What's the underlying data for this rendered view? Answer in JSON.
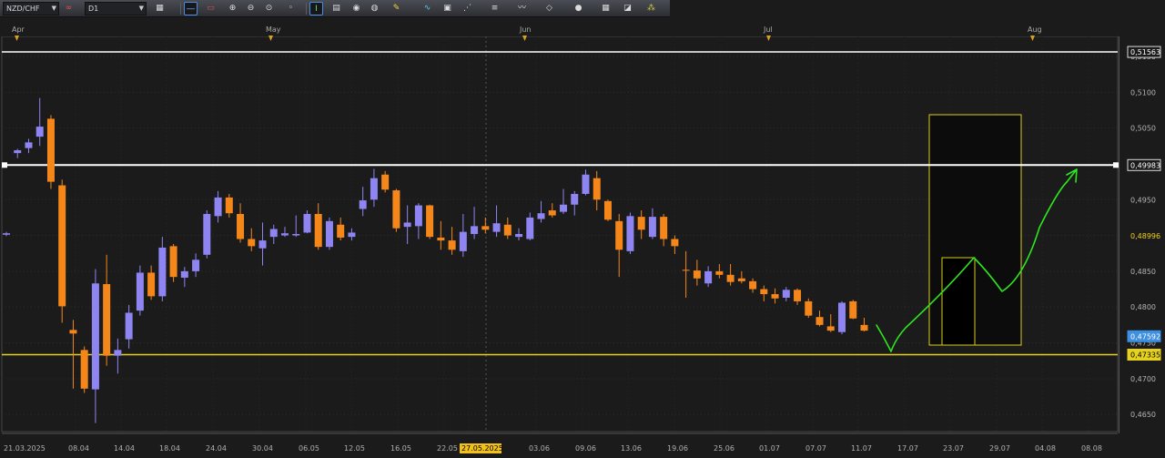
{
  "toolbar": {
    "symbol": "NZD/CHF",
    "timeframe": "D1"
  },
  "colors": {
    "background": "#1b1b1b",
    "bull_candle": "#8e84f2",
    "bear_candle": "#f5871a",
    "support_line": "#e6d21e",
    "resistance_line": "#ffffff",
    "drawn_path": "#2ee61e",
    "current_price_tag": "#3d8fe0"
  },
  "chart_data": {
    "type": "candlestick",
    "y_ticks": [
      "0,5150",
      "0,5100",
      "0,5050",
      "0,5000",
      "0,4950",
      "0,4900",
      "0,4850",
      "0,4800",
      "0,4750",
      "0,4700",
      "0,4650"
    ],
    "y_tick_values": [
      0.515,
      0.51,
      0.505,
      0.5,
      0.495,
      0.49,
      0.485,
      0.48,
      0.475,
      0.47,
      0.465
    ],
    "ylim": [
      0.4626,
      0.5178
    ],
    "x_date_labels": [
      "21.03.2025",
      "08.04",
      "14.04",
      "18.04",
      "24.04",
      "30.04",
      "06.05",
      "12.05",
      "16.05",
      "22.05",
      "27.05.2025",
      "03.06",
      "09.06",
      "13.06",
      "19.06",
      "25.06",
      "01.07",
      "07.07",
      "11.07",
      "17.07",
      "23.07",
      "29.07",
      "04.08",
      "08.08"
    ],
    "months": [
      "Apr",
      "May",
      "Jun",
      "Jul",
      "Aug"
    ],
    "highlighted_date": "27.05.2025",
    "price_tags": [
      {
        "text": "0,51563",
        "value": 0.51563,
        "kind": "line-white"
      },
      {
        "text": "0,49983",
        "value": 0.49983,
        "kind": "line-white"
      },
      {
        "text": "0,48996",
        "value": 0.48996,
        "kind": "yellow-text"
      },
      {
        "text": "0,47592",
        "value": 0.47592,
        "kind": "current"
      },
      {
        "text": "0,47335",
        "value": 0.47335,
        "kind": "support"
      }
    ],
    "horizontal_lines": [
      {
        "name": "top-resistance",
        "value": 0.51563,
        "color": "#ffffff"
      },
      {
        "name": "resistance",
        "value": 0.49983,
        "color": "#ffffff"
      },
      {
        "name": "support",
        "value": 0.47335,
        "color": "#e6d21e"
      }
    ],
    "candles": [
      {
        "i": 0,
        "o": 0.4901,
        "h": 0.4905,
        "l": 0.4899,
        "c": 0.4903
      },
      {
        "i": 1,
        "o": 0.5015,
        "h": 0.5021,
        "l": 0.5008,
        "c": 0.5019
      },
      {
        "i": 2,
        "o": 0.5022,
        "h": 0.5035,
        "l": 0.5015,
        "c": 0.503
      },
      {
        "i": 3,
        "o": 0.5038,
        "h": 0.5092,
        "l": 0.5025,
        "c": 0.5052
      },
      {
        "i": 4,
        "o": 0.5063,
        "h": 0.5068,
        "l": 0.4965,
        "c": 0.4975
      },
      {
        "i": 5,
        "o": 0.497,
        "h": 0.4978,
        "l": 0.4778,
        "c": 0.4801
      },
      {
        "i": 6,
        "o": 0.4768,
        "h": 0.4782,
        "l": 0.4686,
        "c": 0.4763
      },
      {
        "i": 7,
        "o": 0.474,
        "h": 0.4745,
        "l": 0.468,
        "c": 0.4686
      },
      {
        "i": 8,
        "o": 0.4685,
        "h": 0.4853,
        "l": 0.4638,
        "c": 0.4833
      },
      {
        "i": 9,
        "o": 0.4832,
        "h": 0.4873,
        "l": 0.4718,
        "c": 0.4732
      },
      {
        "i": 10,
        "o": 0.4732,
        "h": 0.4756,
        "l": 0.4707,
        "c": 0.474
      },
      {
        "i": 11,
        "o": 0.4755,
        "h": 0.4803,
        "l": 0.4742,
        "c": 0.4792
      },
      {
        "i": 12,
        "o": 0.4795,
        "h": 0.4858,
        "l": 0.4788,
        "c": 0.4848
      },
      {
        "i": 13,
        "o": 0.4848,
        "h": 0.4858,
        "l": 0.481,
        "c": 0.4815
      },
      {
        "i": 14,
        "o": 0.4815,
        "h": 0.4898,
        "l": 0.4808,
        "c": 0.4883
      },
      {
        "i": 15,
        "o": 0.4885,
        "h": 0.4888,
        "l": 0.4835,
        "c": 0.4842
      },
      {
        "i": 16,
        "o": 0.4841,
        "h": 0.4856,
        "l": 0.4828,
        "c": 0.485
      },
      {
        "i": 17,
        "o": 0.485,
        "h": 0.4875,
        "l": 0.4842,
        "c": 0.4866
      },
      {
        "i": 18,
        "o": 0.4873,
        "h": 0.4935,
        "l": 0.4868,
        "c": 0.493
      },
      {
        "i": 19,
        "o": 0.4927,
        "h": 0.4962,
        "l": 0.4918,
        "c": 0.4953
      },
      {
        "i": 20,
        "o": 0.4953,
        "h": 0.4958,
        "l": 0.4925,
        "c": 0.4931
      },
      {
        "i": 21,
        "o": 0.493,
        "h": 0.4945,
        "l": 0.489,
        "c": 0.4895
      },
      {
        "i": 22,
        "o": 0.4895,
        "h": 0.491,
        "l": 0.4878,
        "c": 0.4885
      },
      {
        "i": 23,
        "o": 0.4882,
        "h": 0.4918,
        "l": 0.4858,
        "c": 0.4893
      },
      {
        "i": 24,
        "o": 0.4898,
        "h": 0.4915,
        "l": 0.4888,
        "c": 0.4909
      },
      {
        "i": 25,
        "o": 0.49,
        "h": 0.4912,
        "l": 0.4898,
        "c": 0.4903
      },
      {
        "i": 26,
        "o": 0.49,
        "h": 0.4928,
        "l": 0.4898,
        "c": 0.4902
      },
      {
        "i": 27,
        "o": 0.4904,
        "h": 0.4935,
        "l": 0.4903,
        "c": 0.493
      },
      {
        "i": 28,
        "o": 0.493,
        "h": 0.4945,
        "l": 0.488,
        "c": 0.4884
      },
      {
        "i": 29,
        "o": 0.4884,
        "h": 0.4925,
        "l": 0.488,
        "c": 0.492
      },
      {
        "i": 30,
        "o": 0.4915,
        "h": 0.4925,
        "l": 0.4893,
        "c": 0.4897
      },
      {
        "i": 31,
        "o": 0.4898,
        "h": 0.491,
        "l": 0.4893,
        "c": 0.4904
      },
      {
        "i": 32,
        "o": 0.4937,
        "h": 0.4968,
        "l": 0.4927,
        "c": 0.4949
      },
      {
        "i": 33,
        "o": 0.495,
        "h": 0.4993,
        "l": 0.494,
        "c": 0.498
      },
      {
        "i": 34,
        "o": 0.4985,
        "h": 0.499,
        "l": 0.496,
        "c": 0.4964
      },
      {
        "i": 35,
        "o": 0.4963,
        "h": 0.4965,
        "l": 0.4905,
        "c": 0.491
      },
      {
        "i": 36,
        "o": 0.4912,
        "h": 0.4942,
        "l": 0.4888,
        "c": 0.4918
      },
      {
        "i": 37,
        "o": 0.4913,
        "h": 0.4945,
        "l": 0.4895,
        "c": 0.4942
      },
      {
        "i": 38,
        "o": 0.4942,
        "h": 0.4943,
        "l": 0.4895,
        "c": 0.4898
      },
      {
        "i": 39,
        "o": 0.4897,
        "h": 0.492,
        "l": 0.488,
        "c": 0.4893
      },
      {
        "i": 40,
        "o": 0.4893,
        "h": 0.4912,
        "l": 0.4873,
        "c": 0.488
      },
      {
        "i": 41,
        "o": 0.4878,
        "h": 0.493,
        "l": 0.487,
        "c": 0.4905
      },
      {
        "i": 42,
        "o": 0.4902,
        "h": 0.494,
        "l": 0.4895,
        "c": 0.4913
      },
      {
        "i": 43,
        "o": 0.4913,
        "h": 0.4925,
        "l": 0.4903,
        "c": 0.4908
      },
      {
        "i": 44,
        "o": 0.4905,
        "h": 0.4942,
        "l": 0.4898,
        "c": 0.4917
      },
      {
        "i": 45,
        "o": 0.4915,
        "h": 0.4925,
        "l": 0.4895,
        "c": 0.49
      },
      {
        "i": 46,
        "o": 0.4898,
        "h": 0.491,
        "l": 0.4893,
        "c": 0.4902
      },
      {
        "i": 47,
        "o": 0.4895,
        "h": 0.4932,
        "l": 0.4893,
        "c": 0.4925
      },
      {
        "i": 48,
        "o": 0.4923,
        "h": 0.4948,
        "l": 0.4918,
        "c": 0.4931
      },
      {
        "i": 49,
        "o": 0.4935,
        "h": 0.4945,
        "l": 0.4925,
        "c": 0.4928
      },
      {
        "i": 50,
        "o": 0.4933,
        "h": 0.4965,
        "l": 0.493,
        "c": 0.4943
      },
      {
        "i": 51,
        "o": 0.4943,
        "h": 0.4962,
        "l": 0.4928,
        "c": 0.4958
      },
      {
        "i": 52,
        "o": 0.4958,
        "h": 0.4992,
        "l": 0.4956,
        "c": 0.4985
      },
      {
        "i": 53,
        "o": 0.498,
        "h": 0.499,
        "l": 0.4935,
        "c": 0.495
      },
      {
        "i": 54,
        "o": 0.4948,
        "h": 0.495,
        "l": 0.492,
        "c": 0.4922
      },
      {
        "i": 55,
        "o": 0.492,
        "h": 0.493,
        "l": 0.4842,
        "c": 0.488
      },
      {
        "i": 56,
        "o": 0.4878,
        "h": 0.4932,
        "l": 0.4874,
        "c": 0.4927
      },
      {
        "i": 57,
        "o": 0.4926,
        "h": 0.4935,
        "l": 0.4895,
        "c": 0.4908
      },
      {
        "i": 58,
        "o": 0.4898,
        "h": 0.4938,
        "l": 0.4895,
        "c": 0.4926
      },
      {
        "i": 59,
        "o": 0.4926,
        "h": 0.493,
        "l": 0.4885,
        "c": 0.4895
      },
      {
        "i": 60,
        "o": 0.4895,
        "h": 0.49,
        "l": 0.4874,
        "c": 0.4885
      },
      {
        "i": 61,
        "o": 0.4852,
        "h": 0.4878,
        "l": 0.4813,
        "c": 0.4851
      },
      {
        "i": 62,
        "o": 0.4851,
        "h": 0.4866,
        "l": 0.483,
        "c": 0.484
      },
      {
        "i": 63,
        "o": 0.4833,
        "h": 0.4857,
        "l": 0.4828,
        "c": 0.485
      },
      {
        "i": 64,
        "o": 0.485,
        "h": 0.486,
        "l": 0.484,
        "c": 0.4845
      },
      {
        "i": 65,
        "o": 0.4845,
        "h": 0.486,
        "l": 0.483,
        "c": 0.4835
      },
      {
        "i": 66,
        "o": 0.484,
        "h": 0.485,
        "l": 0.4833,
        "c": 0.4836
      },
      {
        "i": 67,
        "o": 0.4836,
        "h": 0.484,
        "l": 0.482,
        "c": 0.4825
      },
      {
        "i": 68,
        "o": 0.4825,
        "h": 0.483,
        "l": 0.4808,
        "c": 0.4818
      },
      {
        "i": 69,
        "o": 0.4818,
        "h": 0.4826,
        "l": 0.4805,
        "c": 0.4812
      },
      {
        "i": 70,
        "o": 0.4813,
        "h": 0.4828,
        "l": 0.4808,
        "c": 0.4824
      },
      {
        "i": 71,
        "o": 0.4824,
        "h": 0.4826,
        "l": 0.4803,
        "c": 0.4808
      },
      {
        "i": 72,
        "o": 0.4808,
        "h": 0.4812,
        "l": 0.4785,
        "c": 0.4788
      },
      {
        "i": 73,
        "o": 0.4786,
        "h": 0.4795,
        "l": 0.4773,
        "c": 0.4775
      },
      {
        "i": 74,
        "o": 0.4773,
        "h": 0.479,
        "l": 0.4765,
        "c": 0.4767
      },
      {
        "i": 75,
        "o": 0.4765,
        "h": 0.4808,
        "l": 0.4762,
        "c": 0.4806
      },
      {
        "i": 76,
        "o": 0.4808,
        "h": 0.481,
        "l": 0.4783,
        "c": 0.4784
      },
      {
        "i": 77,
        "o": 0.4775,
        "h": 0.4785,
        "l": 0.4766,
        "c": 0.4767
      }
    ]
  }
}
